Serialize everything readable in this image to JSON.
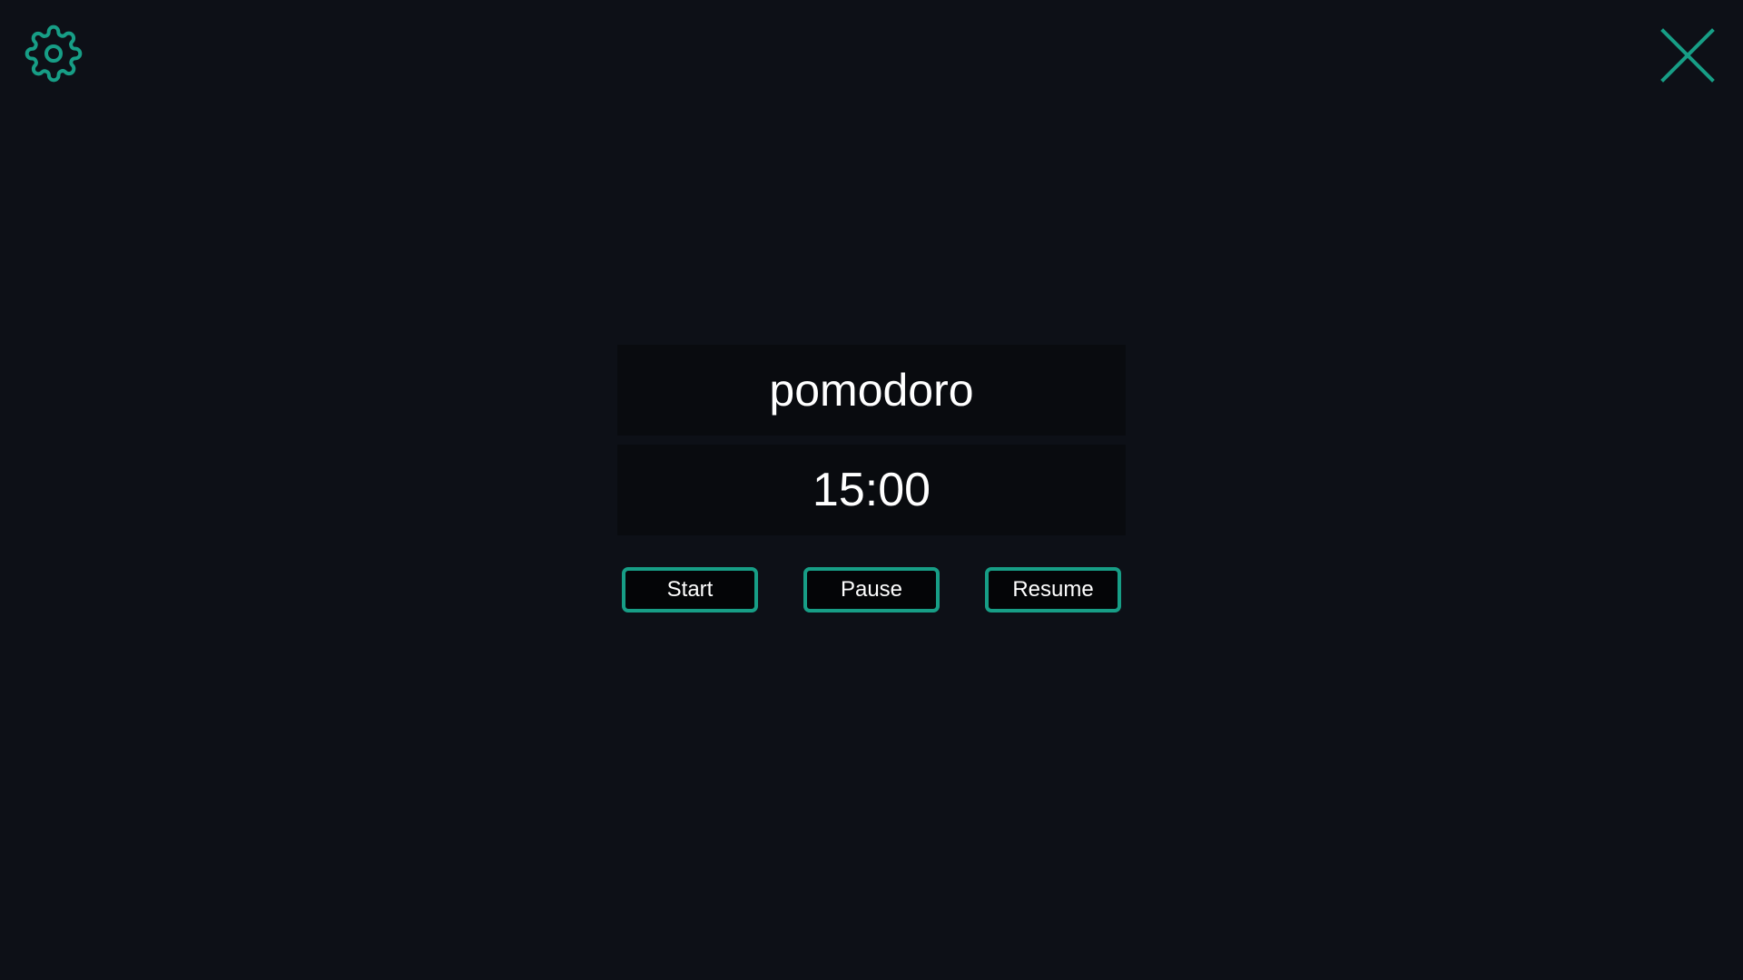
{
  "app": {
    "session_label": "pomodoro",
    "time_remaining": "15:00"
  },
  "controls": {
    "start_label": "Start",
    "pause_label": "Pause",
    "resume_label": "Resume"
  },
  "icons": {
    "settings": "gear-icon",
    "close": "close-icon"
  },
  "colors": {
    "background": "#0d1017",
    "panel": "#090b0f",
    "accent": "#179e86",
    "text": "#ffffff"
  }
}
